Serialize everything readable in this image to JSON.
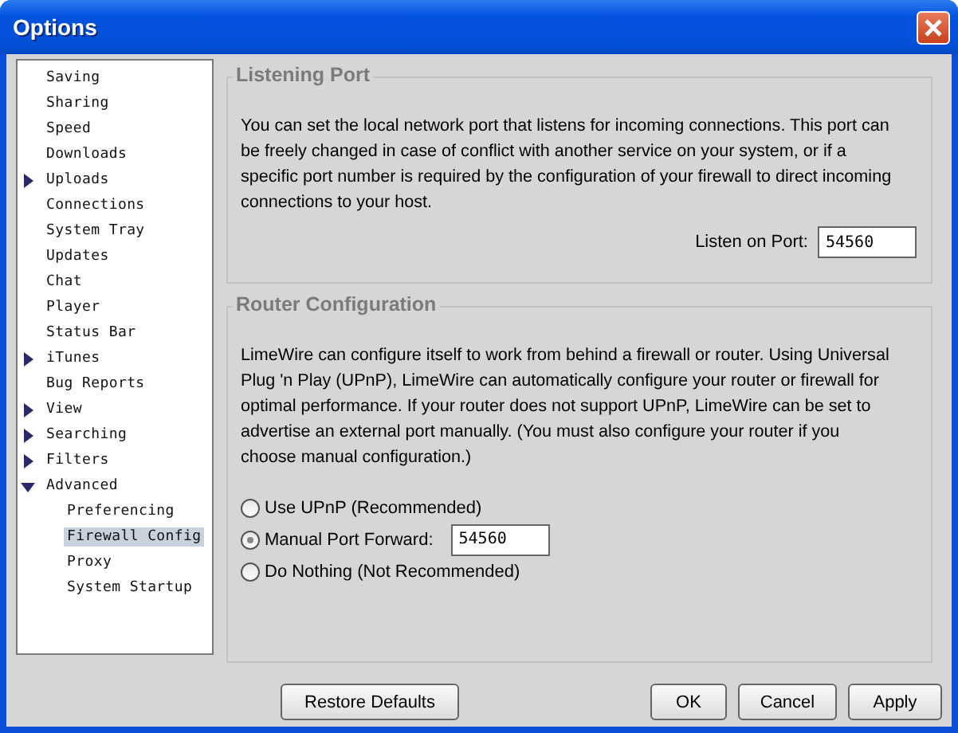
{
  "window": {
    "title": "Options"
  },
  "sidebar": {
    "items": [
      {
        "label": "Saving",
        "kind": "leaf",
        "selected": false
      },
      {
        "label": "Sharing",
        "kind": "leaf",
        "selected": false
      },
      {
        "label": "Speed",
        "kind": "leaf",
        "selected": false
      },
      {
        "label": "Downloads",
        "kind": "leaf",
        "selected": false
      },
      {
        "label": "Uploads",
        "kind": "branch",
        "expanded": false,
        "selected": false
      },
      {
        "label": "Connections",
        "kind": "leaf",
        "selected": false
      },
      {
        "label": "System Tray",
        "kind": "leaf",
        "selected": false
      },
      {
        "label": "Updates",
        "kind": "leaf",
        "selected": false
      },
      {
        "label": "Chat",
        "kind": "leaf",
        "selected": false
      },
      {
        "label": "Player",
        "kind": "leaf",
        "selected": false
      },
      {
        "label": "Status Bar",
        "kind": "leaf",
        "selected": false
      },
      {
        "label": "iTunes",
        "kind": "branch",
        "expanded": false,
        "selected": false
      },
      {
        "label": "Bug Reports",
        "kind": "leaf",
        "selected": false
      },
      {
        "label": "View",
        "kind": "branch",
        "expanded": false,
        "selected": false
      },
      {
        "label": "Searching",
        "kind": "branch",
        "expanded": false,
        "selected": false
      },
      {
        "label": "Filters",
        "kind": "branch",
        "expanded": false,
        "selected": false
      },
      {
        "label": "Advanced",
        "kind": "branch",
        "expanded": true,
        "selected": false,
        "children": [
          {
            "label": "Preferencing",
            "selected": false
          },
          {
            "label": "Firewall Config",
            "selected": true
          },
          {
            "label": "Proxy",
            "selected": false
          },
          {
            "label": "System Startup",
            "selected": false
          }
        ]
      }
    ]
  },
  "listening_port": {
    "title": "Listening Port",
    "text": "You can set the local network port that listens for incoming connections. This port can be freely changed in case of conflict with another service on your system, or if a specific port number is required by the configuration of your firewall to direct incoming connections to your host.",
    "field_label": "Listen on Port:",
    "value": "54560"
  },
  "router_configuration": {
    "title": "Router Configuration",
    "text": "LimeWire can configure itself to work from behind a firewall or router. Using Universal Plug 'n Play (UPnP), LimeWire can automatically configure your router or firewall for optimal performance. If your router does not support UPnP, LimeWire can be set to advertise an external port manually. (You must also configure your router if you choose manual configuration.)",
    "options": [
      {
        "label": "Use UPnP (Recommended)",
        "selected": false
      },
      {
        "label": "Manual Port Forward:",
        "selected": true,
        "value": "54560"
      },
      {
        "label": "Do Nothing (Not Recommended)",
        "selected": false
      }
    ]
  },
  "buttons": {
    "left": [
      "Restore Defaults"
    ],
    "right": [
      "OK",
      "Cancel",
      "Apply"
    ]
  }
}
